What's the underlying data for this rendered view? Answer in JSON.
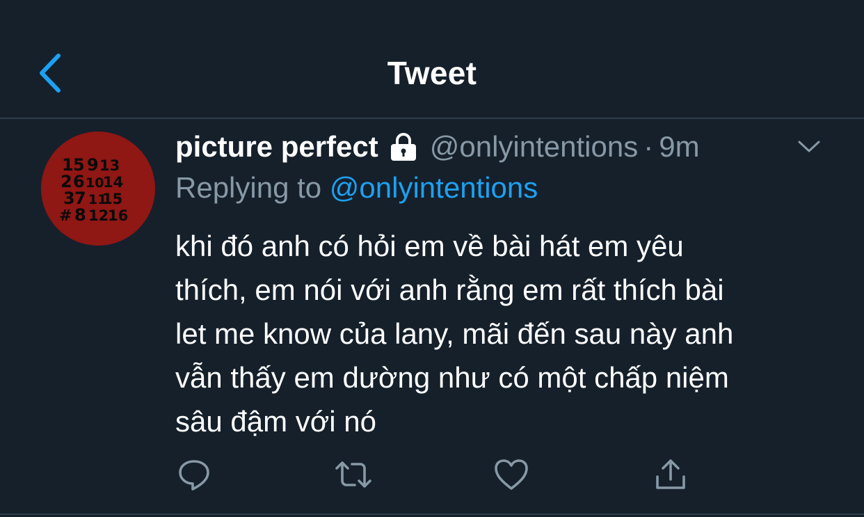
{
  "header": {
    "title": "Tweet",
    "back_icon": "chevron-left-icon",
    "accent_color": "#1da1f2"
  },
  "tweet": {
    "avatar": {
      "icon": "avatar-number-grid",
      "background_color": "#8f1714",
      "grid_rows": [
        "15913",
        "261014",
        "371115",
        "#81216"
      ]
    },
    "display_name": "picture perfect",
    "protected_icon": "lock-icon",
    "handle": "@onlyintentions",
    "separator": "·",
    "timestamp": "9m",
    "replying_prefix": "Replying to",
    "replying_handle": "@onlyintentions",
    "text": "khi đó anh có hỏi em về bài hát em yêu\nthích, em nói với anh rằng em rất thích bài\nlet me know của lany, mãi đến sau này anh\nvẫn thấy em dường như có một chấp niệm\nsâu đậm với nó"
  },
  "actions": [
    {
      "name": "reply",
      "icon": "reply-icon"
    },
    {
      "name": "retweet",
      "icon": "retweet-icon"
    },
    {
      "name": "like",
      "icon": "heart-icon"
    },
    {
      "name": "share",
      "icon": "share-icon"
    }
  ],
  "colors": {
    "background": "#15202b",
    "secondary_text": "#8899a6",
    "divider": "#2f3d4c",
    "link": "#1da1f2"
  }
}
